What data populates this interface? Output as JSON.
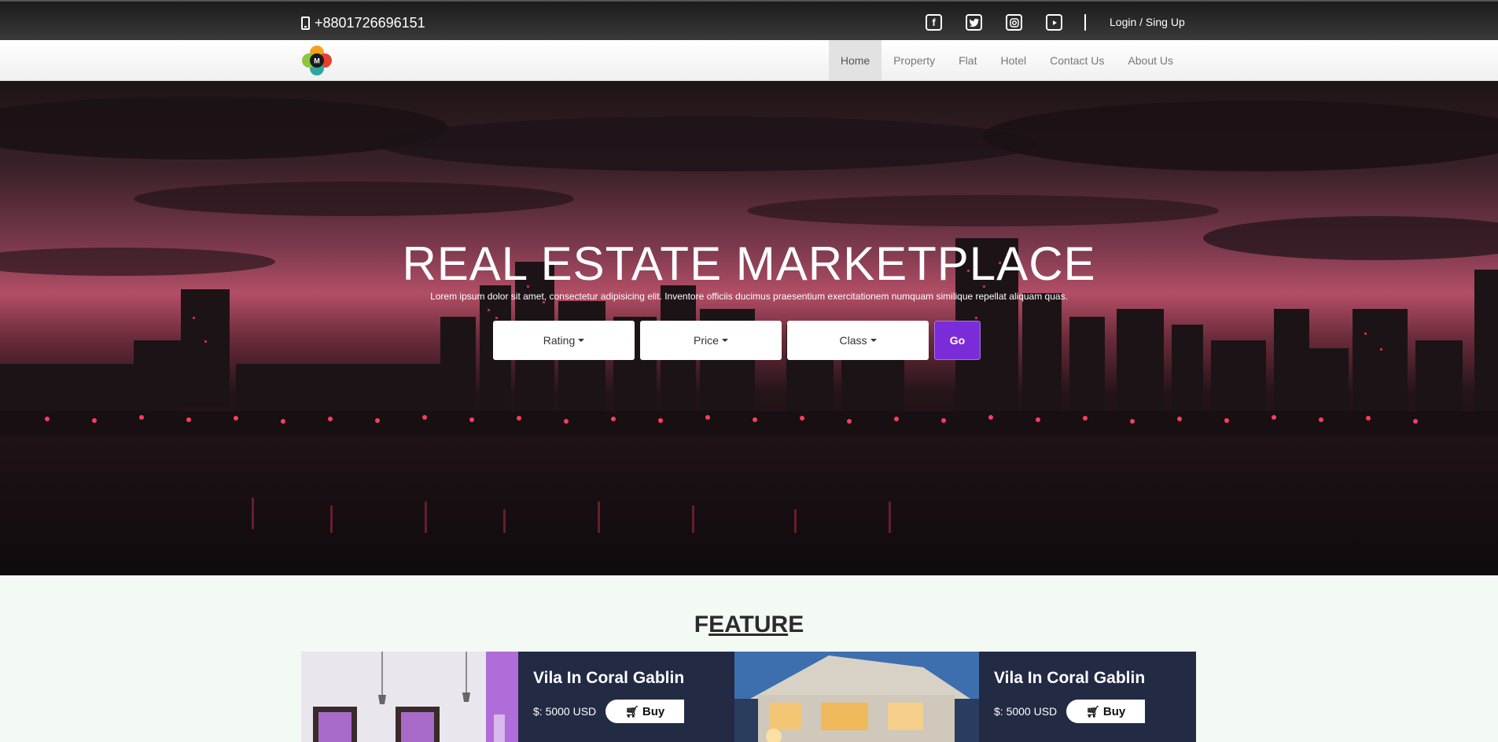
{
  "topbar": {
    "phone": "+8801726696151",
    "social_icons": [
      "facebook-icon",
      "twitter-icon",
      "instagram-icon",
      "youtube-icon"
    ],
    "login": "Login / Sing Up"
  },
  "nav": {
    "logo_letter": "M",
    "links": [
      "Home",
      "Property",
      "Flat",
      "Hotel",
      "Contact Us",
      "About Us"
    ],
    "active": "Home"
  },
  "hero": {
    "title": "REAL ESTATE MARKETPLACE",
    "subtitle": "Lorem ipsum dolor sit amet, consectetur adipisicing elit. Inventore officiis ducimus praesentium exercitationem numquam similique repellat aliquam quas.",
    "filters": [
      "Rating",
      "Price",
      "Class"
    ],
    "go": "Go"
  },
  "feature": {
    "title_first": "F",
    "title_underlined": "EATUR",
    "title_last": "E",
    "cards": [
      {
        "name": "Vila In Coral Gablin",
        "price": "$: 5000 USD",
        "buy": "Buy"
      },
      {
        "name": "Vila In Coral Gablin",
        "price": "$: 5000 USD",
        "buy": "Buy"
      }
    ]
  },
  "colors": {
    "accent": "#7b2cd9",
    "card_bg": "#232a44",
    "topbar": "#2a2a2a",
    "page_bg": "#f3faf3"
  }
}
